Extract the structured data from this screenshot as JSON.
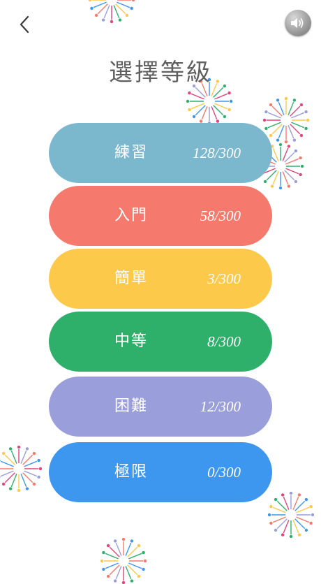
{
  "page_title": "選擇等級",
  "icons": {
    "back": "back-chevron-icon",
    "sound": "speaker-icon"
  },
  "levels": [
    {
      "name": "練習",
      "progress": "128/300",
      "color": "#7bb7cd"
    },
    {
      "name": "入門",
      "progress": "58/300",
      "color": "#f5796c"
    },
    {
      "name": "簡單",
      "progress": "3/300",
      "color": "#fcc94a"
    },
    {
      "name": "中等",
      "progress": "8/300",
      "color": "#2eb06a"
    },
    {
      "name": "困難",
      "progress": "12/300",
      "color": "#9a9edb"
    },
    {
      "name": "極限",
      "progress": "0/300",
      "color": "#3e97ee"
    }
  ]
}
